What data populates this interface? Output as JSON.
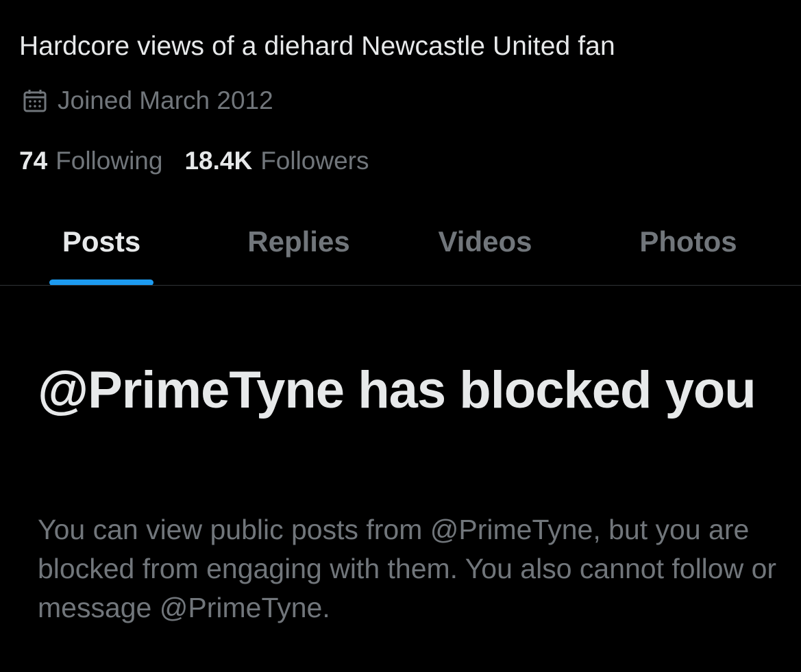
{
  "profile": {
    "bio": "Hardcore views of a diehard Newcastle United fan",
    "joined": "Joined March 2012",
    "joined_icon": "calendar-icon",
    "following_count": "74",
    "following_label": "Following",
    "followers_count": "18.4K",
    "followers_label": "Followers"
  },
  "tabs": [
    {
      "label": "Posts",
      "active": true
    },
    {
      "label": "Replies",
      "active": false
    },
    {
      "label": "Videos",
      "active": false
    },
    {
      "label": "Photos",
      "active": false
    }
  ],
  "blocked": {
    "title": "@PrimeTyne has blocked you",
    "description": "You can view public posts from @PrimeTyne, but you are blocked from engaging with them. You also cannot follow or message @PrimeTyne."
  },
  "colors": {
    "background": "#000000",
    "primary_text": "#e7e9ea",
    "secondary_text": "#71767b",
    "accent": "#1d9bf0",
    "divider": "#2f3336"
  }
}
